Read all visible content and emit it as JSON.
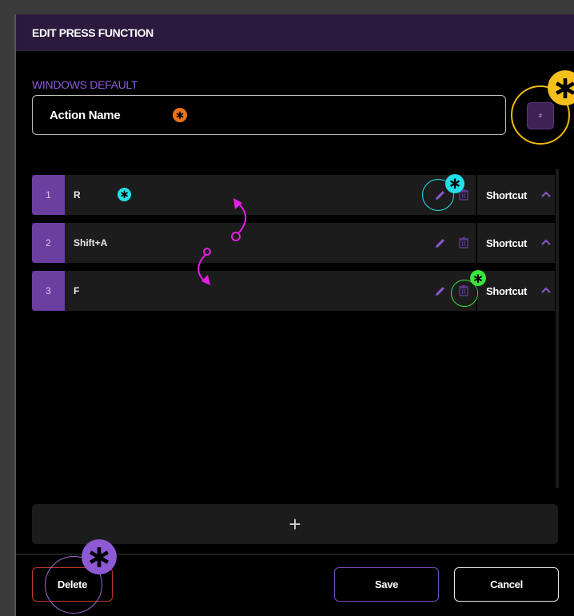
{
  "dialog": {
    "title": "EDIT PRESS FUNCTION"
  },
  "profile": {
    "section_label": "WINDOWS DEFAULT",
    "action_name": "Action Name",
    "icon_glyph": "#"
  },
  "steps": [
    {
      "index": "1",
      "key": "R",
      "type": "Shortcut"
    },
    {
      "index": "2",
      "key": "Shift+A",
      "type": "Shortcut"
    },
    {
      "index": "3",
      "key": "F",
      "type": "Shortcut"
    }
  ],
  "add_label": "+",
  "buttons": {
    "delete": "Delete",
    "save": "Save",
    "cancel": "Cancel"
  },
  "markers": {
    "glyph": "∗"
  },
  "colors": {
    "accent_purple": "#6b3fa0",
    "title_bar": "#2b1a3d",
    "marker_yellow": "#f5c01c",
    "marker_cyan": "#22e0e8",
    "marker_green": "#38e838",
    "marker_orange": "#e8741a",
    "marker_purple": "#8d5ad4",
    "arrow_magenta": "#e81ee8",
    "delete_border": "#c0392b"
  },
  "icons": {
    "edit": "pencil-icon",
    "delete": "trash-icon",
    "expand": "chevron-up-icon"
  }
}
